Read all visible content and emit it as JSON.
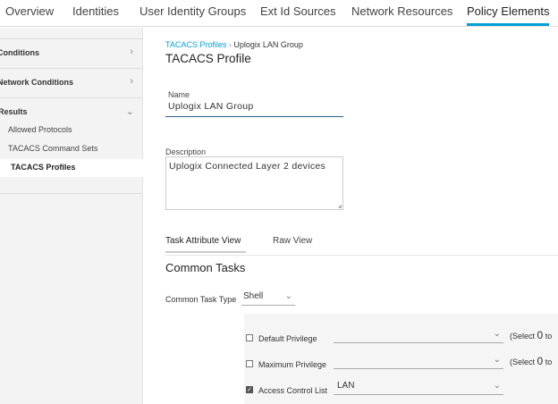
{
  "nav": {
    "tabs": [
      "Overview",
      "Identities",
      "User Identity Groups",
      "Ext Id Sources",
      "Network Resources",
      "Policy Elements"
    ]
  },
  "sidebar": {
    "conditions": "Conditions",
    "network_conditions": "Network Conditions",
    "results": "Results",
    "items": [
      "Allowed Protocols",
      "TACACS Command Sets",
      "TACACS Profiles"
    ]
  },
  "breadcrumb": {
    "parent": "TACACS Profiles",
    "current": "Uplogix LAN Group"
  },
  "title": "TACACS Profile",
  "form": {
    "name_label": "Name",
    "name_value": "Uplogix LAN Group",
    "desc_label": "Description",
    "desc_value": "Uplogix Connected Layer 2 devices"
  },
  "view_tabs": [
    "Task Attribute View",
    "Raw View"
  ],
  "common": {
    "title": "Common Tasks",
    "type_label": "Common Task Type",
    "type_value": "Shell"
  },
  "rows": [
    {
      "label": "Default Privilege",
      "value": "",
      "checked": false,
      "hint_pre": "(Select ",
      "hint_num": "0",
      "hint_post": " to"
    },
    {
      "label": "Maximum Privilege",
      "value": "",
      "checked": false,
      "hint_pre": "(Select ",
      "hint_num": "0",
      "hint_post": " to"
    },
    {
      "label": "Access Control List",
      "value": "LAN",
      "checked": true
    }
  ]
}
